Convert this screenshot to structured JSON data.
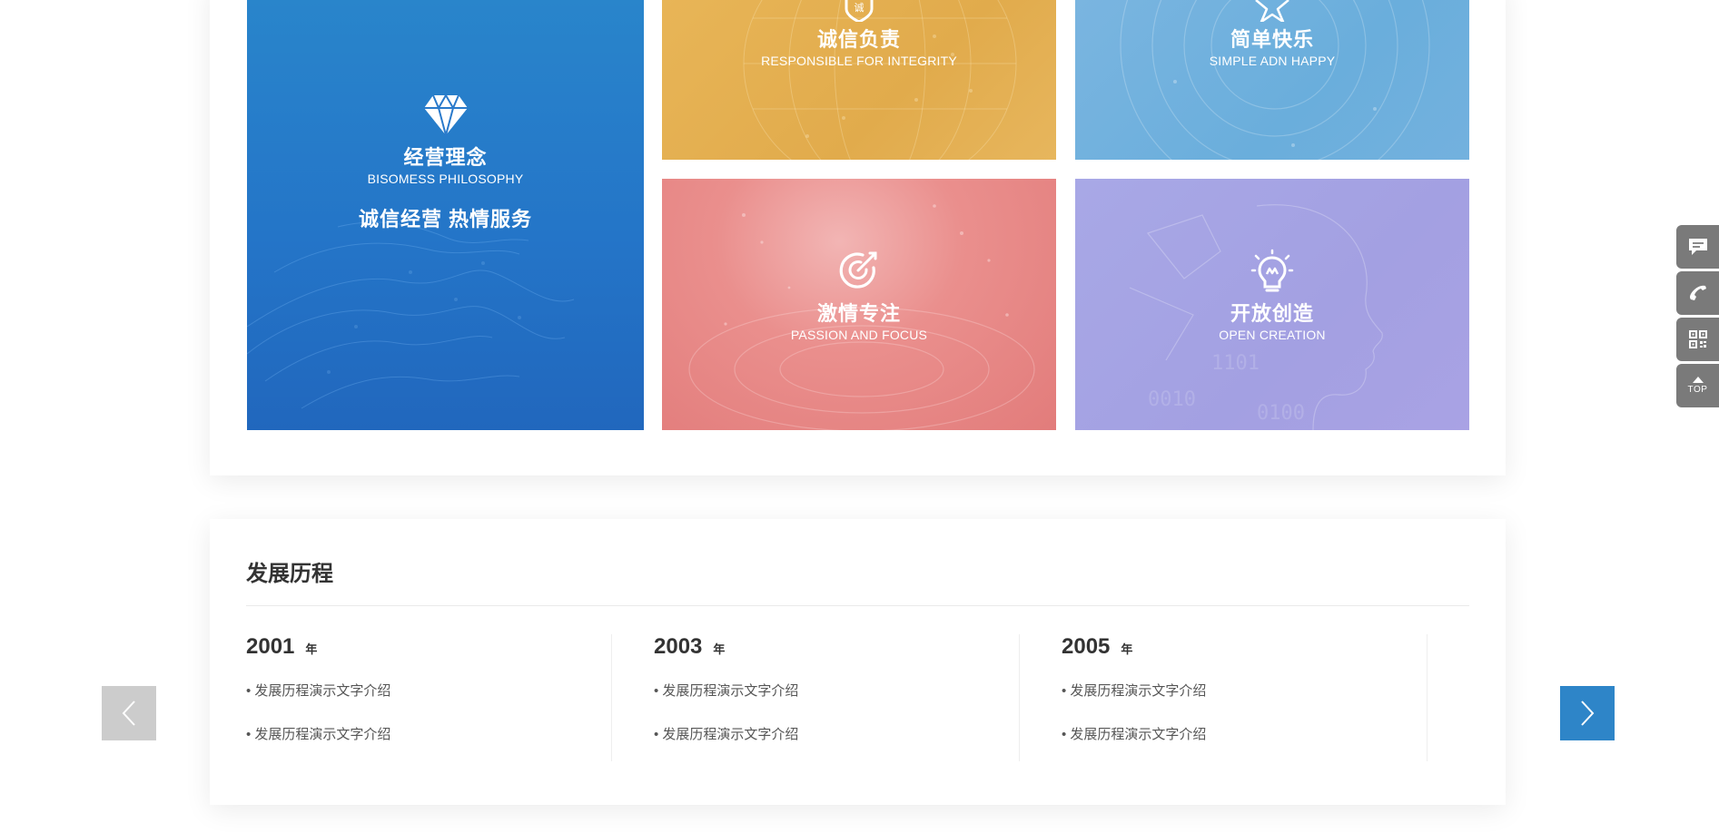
{
  "values": {
    "business": {
      "title": "经营理念",
      "subtitle": "BISOMESS PHILOSOPHY",
      "slogan": "诚信经营 热情服务",
      "icon": "diamond-icon",
      "color": "#2475c8"
    },
    "integrity": {
      "title": "诚信负责",
      "subtitle": "RESPONSIBLE FOR INTEGRITY",
      "icon": "integrity-badge-icon",
      "color": "#e1ab4c"
    },
    "happy": {
      "title": "简单快乐",
      "subtitle": "SIMPLE ADN HAPPY",
      "icon": "star-icon",
      "color": "#6aaedc"
    },
    "passion": {
      "title": "激情专注",
      "subtitle": "PASSION AND FOCUS",
      "icon": "target-icon",
      "color": "#e27c7b"
    },
    "open": {
      "title": "开放创造",
      "subtitle": "OPEN CREATION",
      "icon": "lightbulb-icon",
      "color": "#a3a0e2"
    }
  },
  "history": {
    "title": "发展历程",
    "unit": "年",
    "years": [
      {
        "year": "2001",
        "items": [
          "• 发展历程演示文字介绍",
          "• 发展历程演示文字介绍"
        ]
      },
      {
        "year": "2003",
        "items": [
          "• 发展历程演示文字介绍",
          "• 发展历程演示文字介绍"
        ]
      },
      {
        "year": "2005",
        "items": [
          "• 发展历程演示文字介绍",
          "• 发展历程演示文字介绍"
        ]
      }
    ],
    "prev_icon": "chevron-left-icon",
    "next_icon": "chevron-right-icon",
    "accent": "#2e85c8"
  },
  "float_bar": {
    "buttons": [
      {
        "icon": "message-icon"
      },
      {
        "icon": "phone-icon"
      },
      {
        "icon": "qrcode-icon"
      },
      {
        "icon": "arrow-up-icon",
        "label": "TOP"
      }
    ]
  }
}
